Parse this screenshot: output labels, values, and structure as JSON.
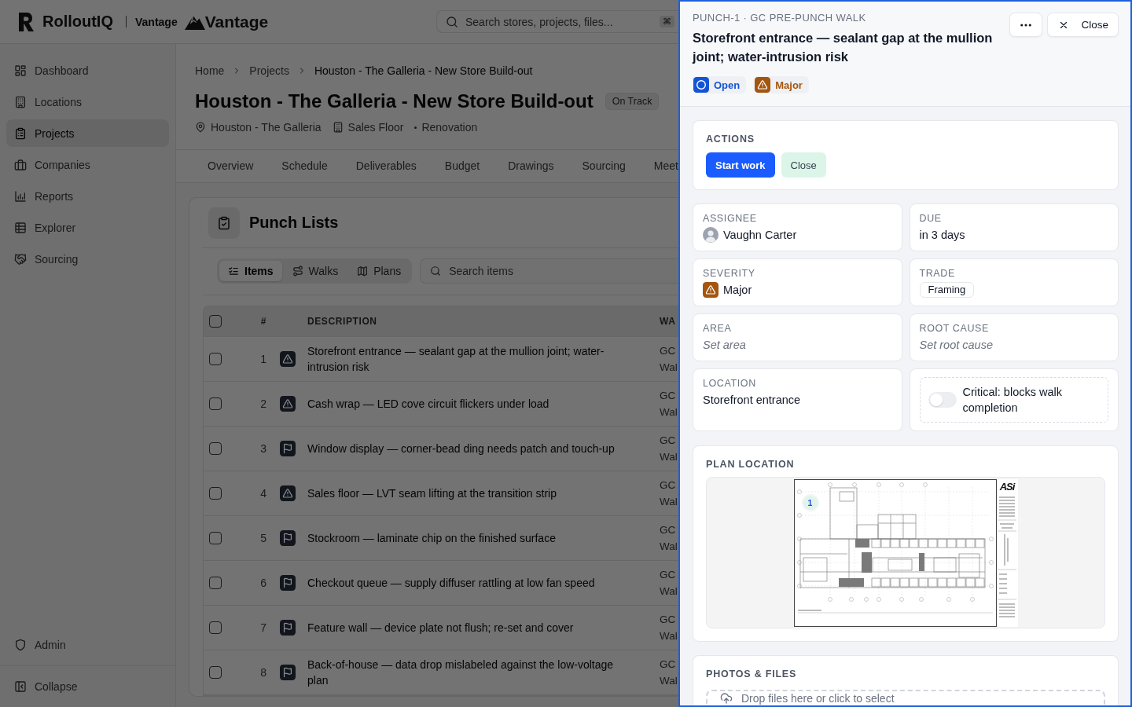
{
  "header": {
    "brand": "RolloutIQ",
    "workspace": "Vantage",
    "partner": "Vantage",
    "search": {
      "placeholder": "Search stores, projects, files...",
      "shortcut": "⌘"
    }
  },
  "sidebar": {
    "items": [
      {
        "label": "Dashboard",
        "selected": false
      },
      {
        "label": "Locations",
        "selected": false
      },
      {
        "label": "Projects",
        "selected": true
      },
      {
        "label": "Companies",
        "selected": false
      },
      {
        "label": "Reports",
        "selected": false
      },
      {
        "label": "Explorer",
        "selected": false
      },
      {
        "label": "Sourcing",
        "selected": false
      }
    ],
    "footer_items": [
      {
        "label": "Admin"
      },
      {
        "label": "Collapse"
      }
    ]
  },
  "project": {
    "breadcrumb": [
      "Home",
      "Projects",
      "Houston - The Galleria - New Store Build-out"
    ],
    "title": "Houston - The Galleria - New Store Build-out",
    "status": "On Track",
    "meta": [
      {
        "kind": "location",
        "label": "Houston - The Galleria"
      },
      {
        "kind": "area",
        "label": "Sales Floor"
      },
      {
        "kind": "category",
        "label": "Renovation"
      }
    ],
    "tabs": [
      {
        "label": "Overview",
        "selected": false
      },
      {
        "label": "Schedule",
        "selected": false
      },
      {
        "label": "Deliverables",
        "selected": false
      },
      {
        "label": "Budget",
        "selected": false
      },
      {
        "label": "Drawings",
        "selected": false
      },
      {
        "label": "Sourcing",
        "selected": false
      },
      {
        "label": "Meet",
        "selected": false
      }
    ]
  },
  "punch_lists": {
    "title": "Punch Lists",
    "views": [
      {
        "label": "Items",
        "selected": true
      },
      {
        "label": "Walks",
        "selected": false
      },
      {
        "label": "Plans",
        "selected": false
      }
    ],
    "search": {
      "placeholder": "Search items"
    },
    "table": {
      "header_checked": false,
      "columns": [
        "#",
        "DESCRIPTION",
        "WA"
      ],
      "rows": [
        {
          "checked": false,
          "number": "1",
          "kind": "major",
          "description": "Storefront entrance — sealant gap at the mullion joint; water-intrusion risk",
          "walk": "GC Wal"
        },
        {
          "checked": false,
          "number": "2",
          "kind": "major",
          "description": "Cash wrap — LED cove circuit flickers under load",
          "walk": "GC Wal"
        },
        {
          "checked": false,
          "number": "3",
          "kind": "minor",
          "description": "Window display — corner-bead ding needs patch and touch-up",
          "walk": "GC Wal"
        },
        {
          "checked": false,
          "number": "4",
          "kind": "major",
          "description": "Sales floor — LVT seam lifting at the transition strip",
          "walk": "GC Wal"
        },
        {
          "checked": false,
          "number": "5",
          "kind": "minor",
          "description": "Stockroom — laminate chip on the finished surface",
          "walk": "GC Wal"
        },
        {
          "checked": false,
          "number": "6",
          "kind": "minor",
          "description": "Checkout queue — supply diffuser rattling at low fan speed",
          "walk": "GC Wal"
        },
        {
          "checked": false,
          "number": "7",
          "kind": "minor",
          "description": "Feature wall — device plate not flush; re-set and cover",
          "walk": "GC Wal"
        },
        {
          "checked": false,
          "number": "8",
          "kind": "minor",
          "description": "Back-of-house — data drop mislabeled against the low-voltage plan",
          "walk": "GC Wal"
        }
      ]
    }
  },
  "drawer": {
    "ref": "PUNCH-1 · GC PRE-PUNCH WALK",
    "title": "Storefront entrance — sealant gap at the mullion joint; water-intrusion risk",
    "close_label": "Close",
    "badges": [
      {
        "kind": "status",
        "label": "Open",
        "color": "#1454d6"
      },
      {
        "kind": "severity",
        "label": "Major",
        "color": "#a4560f"
      }
    ],
    "actions": {
      "title": "ACTIONS",
      "buttons": [
        {
          "kind": "primary",
          "label": "Start work"
        },
        {
          "kind": "secondary",
          "label": "Close"
        }
      ]
    },
    "fields": [
      {
        "kind": "person",
        "label": "ASSIGNEE",
        "value": "Vaughn Carter"
      },
      {
        "kind": "text",
        "label": "DUE",
        "value": "in 3 days"
      },
      {
        "kind": "severity",
        "label": "SEVERITY",
        "value": "Major",
        "color": "#a4560f"
      },
      {
        "kind": "tag",
        "label": "TRADE",
        "value": "Framing"
      },
      {
        "kind": "empty",
        "label": "AREA",
        "placeholder": "Set area"
      },
      {
        "kind": "empty",
        "label": "ROOT CAUSE",
        "placeholder": "Set root cause"
      },
      {
        "kind": "text",
        "label": "LOCATION",
        "value": "Storefront entrance"
      },
      {
        "kind": "toggle",
        "label": "Critical: blocks walk completion",
        "on": false
      }
    ],
    "plan": {
      "title": "PLAN LOCATION",
      "pin": "1",
      "sheet_logo": "ASi"
    },
    "files": {
      "title": "PHOTOS & FILES",
      "dropzone": "Drop files here or click to select"
    }
  }
}
